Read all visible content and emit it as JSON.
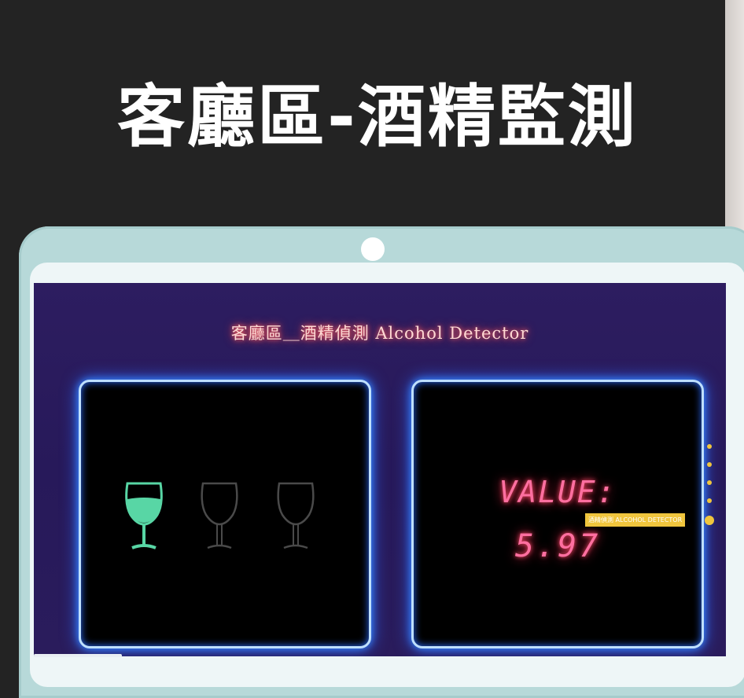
{
  "page": {
    "title": "客廳區-酒精監測"
  },
  "dashboard": {
    "title": "客廳區＿酒精偵測 Alcohol Detector",
    "glasses": [
      {
        "name": "glass-1",
        "filled": true,
        "color": "#58d6a5"
      },
      {
        "name": "glass-2",
        "filled": false,
        "color": "#4a4a4a"
      },
      {
        "name": "glass-3",
        "filled": false,
        "color": "#4a4a4a"
      }
    ],
    "value_label": "VALUE:",
    "value": "5.97"
  },
  "navigation": {
    "tooltip": "酒精偵測 ALCOHOL DETECTOR",
    "dot_count": 5,
    "active_index": 4,
    "accent_color": "#f0c53d"
  }
}
